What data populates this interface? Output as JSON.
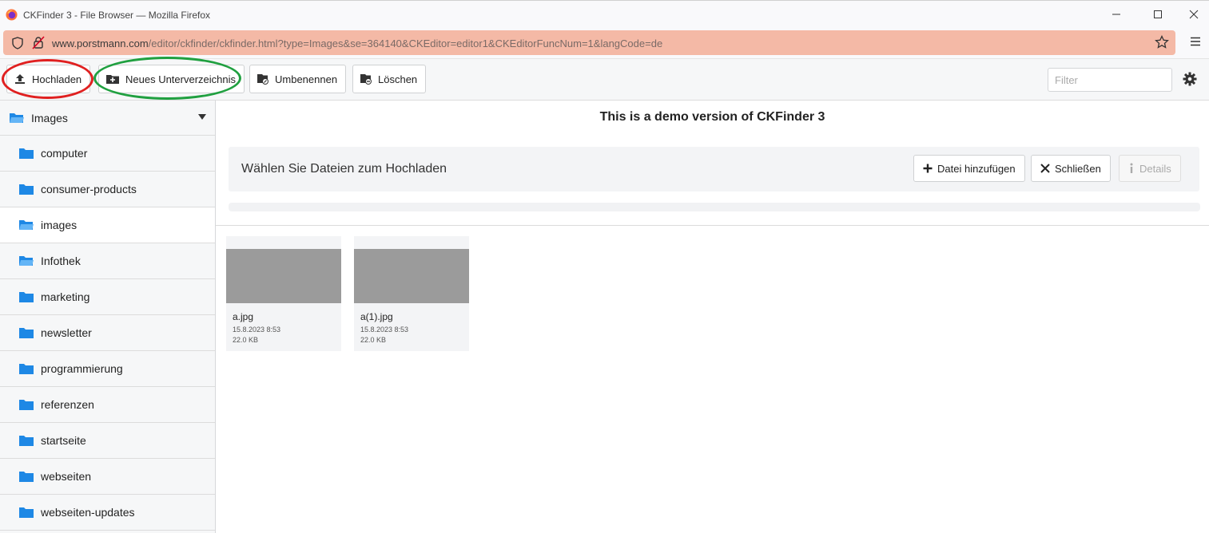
{
  "browser": {
    "window_title": "CKFinder 3 - File Browser — Mozilla Firefox",
    "url_host": "www.porstmann.com",
    "url_path": "/editor/ckfinder/ckfinder.html?type=Images&se=364140&CKEditor=editor1&CKEditorFuncNum=1&langCode=de"
  },
  "toolbar": {
    "upload_label": "Hochladen",
    "new_folder_label": "Neues Unterverzeichnis",
    "rename_label": "Umbenennen",
    "delete_label": "Löschen",
    "filter_placeholder": "Filter"
  },
  "annotations": {
    "upload_circle_color": "#e02020",
    "new_folder_circle_color": "#20a040"
  },
  "sidebar": {
    "root_label": "Images",
    "items": [
      {
        "label": "computer"
      },
      {
        "label": "consumer-products"
      },
      {
        "label": "images"
      },
      {
        "label": "Infothek"
      },
      {
        "label": "marketing"
      },
      {
        "label": "newsletter"
      },
      {
        "label": "programmierung"
      },
      {
        "label": "referenzen"
      },
      {
        "label": "startseite"
      },
      {
        "label": "webseiten"
      },
      {
        "label": "webseiten-updates"
      }
    ]
  },
  "main": {
    "demo_notice": "This is a demo version of CKFinder 3",
    "upload_panel": {
      "message": "Wählen Sie Dateien zum Hochladen",
      "add_file_label": "Datei hinzufügen",
      "close_label": "Schließen",
      "details_label": "Details"
    },
    "files": [
      {
        "name": "a.jpg",
        "date": "15.8.2023 8:53",
        "size": "22.0 KB"
      },
      {
        "name": "a(1).jpg",
        "date": "15.8.2023 8:53",
        "size": "22.0 KB"
      }
    ]
  },
  "colors": {
    "accent_folder": "#1e88e5",
    "urlbar_bg": "#f4b9a6"
  }
}
